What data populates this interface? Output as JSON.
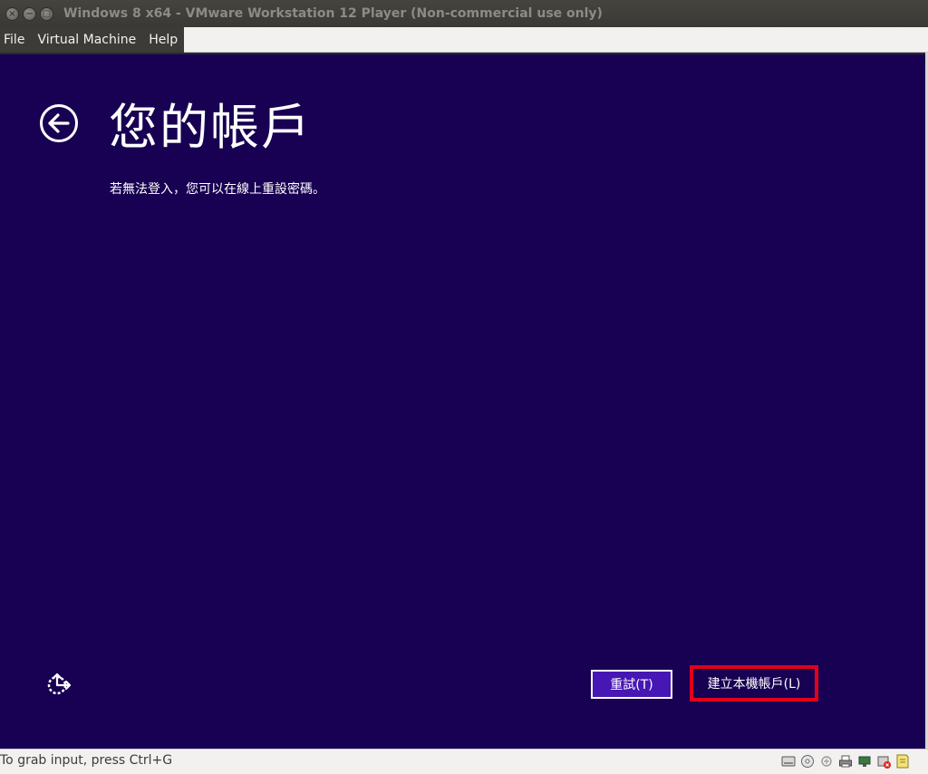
{
  "window": {
    "title": "Windows 8 x64 - VMware Workstation 12 Player (Non-commercial use only)",
    "controls": [
      "close",
      "minimize",
      "maximize"
    ]
  },
  "menu": {
    "items": [
      "File",
      "Virtual Machine",
      "Help"
    ]
  },
  "setup": {
    "title": "您的帳戶",
    "subtitle": "若無法登入，您可以在線上重設密碼。",
    "retry_label": "重試(T)",
    "create_local_label": "建立本機帳戶(L)"
  },
  "status": {
    "text": "To grab input, press Ctrl+G",
    "tray_icons": [
      "hard-disk-icon",
      "cd-dvd-icon",
      "usb-icon",
      "printer-icon",
      "network-icon",
      "sound-icon",
      "message-icon"
    ]
  },
  "colors": {
    "screen_bg": "#180052",
    "retry_bg": "#4617b4",
    "highlight": "#e2001b"
  }
}
